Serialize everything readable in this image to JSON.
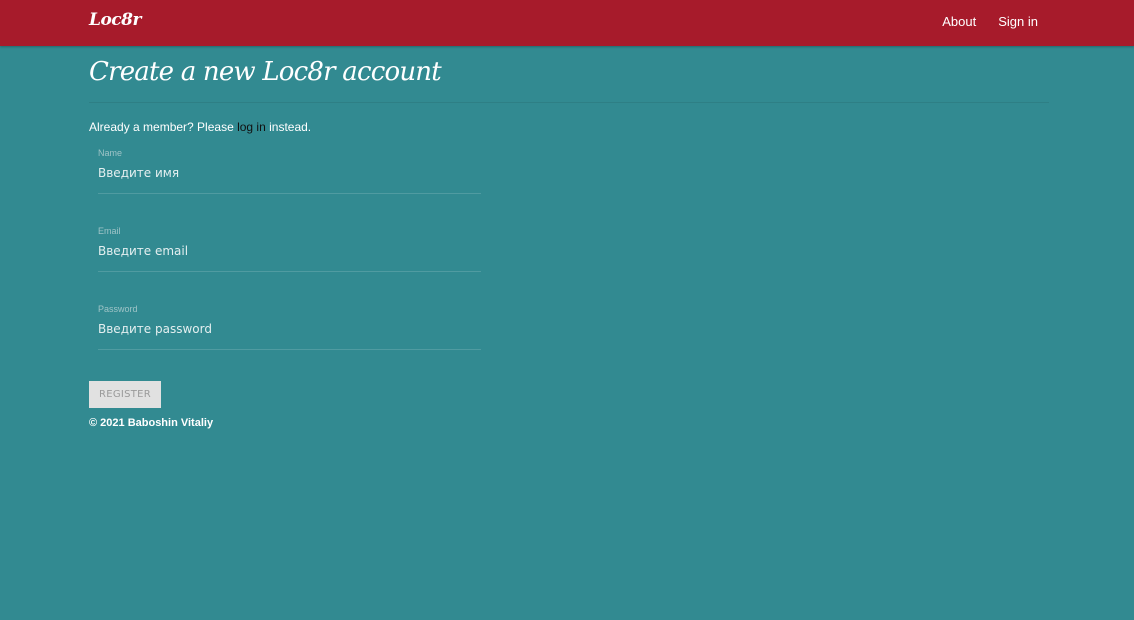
{
  "navbar": {
    "brand": "Loc8r",
    "links": [
      {
        "label": "About"
      },
      {
        "label": "Sign in"
      }
    ]
  },
  "header": {
    "title": "Create a new Loc8r account"
  },
  "intro": {
    "prefix": "Already a member? Please ",
    "link": "log in",
    "suffix": " instead."
  },
  "form": {
    "name": {
      "label": "Name",
      "placeholder": "Введите имя",
      "value": ""
    },
    "email": {
      "label": "Email",
      "placeholder": "Введите email",
      "value": ""
    },
    "password": {
      "label": "Password",
      "placeholder": "Введите password",
      "value": ""
    },
    "submit_label": "REGISTER"
  },
  "footer": {
    "text": "© 2021 Baboshin Vitaliy"
  },
  "colors": {
    "background": "#328a91",
    "navbar": "#a71b2b",
    "button": "#e1e1e1"
  }
}
